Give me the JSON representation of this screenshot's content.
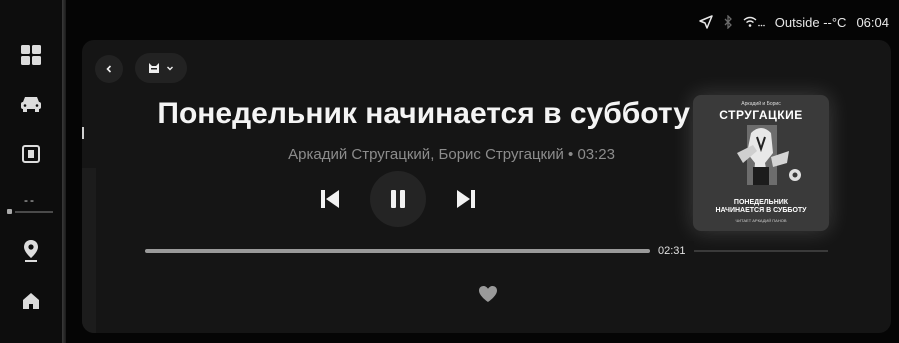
{
  "status": {
    "outside_label": "Outside",
    "temperature": "--°C",
    "time": "06:04"
  },
  "track": {
    "title": "Понедельник начинается в субботу",
    "subtitle": "Аркадий Стругацкий, Борис Стругацкий • 03:23",
    "elapsed": "02:31",
    "duration": "03:23",
    "progress_fraction": 0.74,
    "liked": true
  },
  "cover": {
    "top_text": "Аркадий и Борис",
    "author_title": "СТРУГАЦКИЕ",
    "book_line1": "ПОНЕДЕЛЬНИК",
    "book_line2": "НАЧИНАЕТСЯ В СУББОТУ",
    "reader_line": "ЧИТАЕТ АРКАДИЙ ПАНОВ"
  },
  "dock": {
    "icons": [
      "apps-icon",
      "car-icon",
      "book-app-icon",
      "media-icon",
      "location-icon",
      "home-icon"
    ],
    "media_dashes": "--"
  },
  "icons": {
    "back": "chevron-left-icon",
    "source": "cat-icon",
    "source_dropdown": "chevron-down-icon",
    "prev": "skip-previous-icon",
    "pause": "pause-icon",
    "next": "skip-next-icon",
    "like": "heart-icon",
    "status": [
      "navigation-arrow-icon",
      "bluetooth-icon",
      "wifi-icon"
    ]
  }
}
